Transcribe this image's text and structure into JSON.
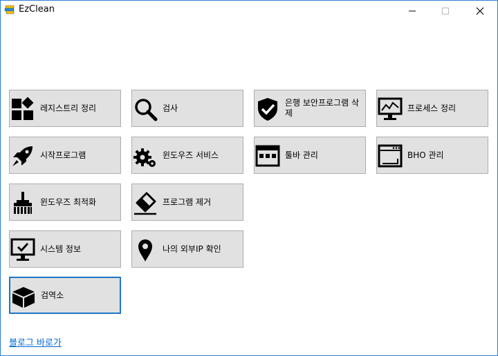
{
  "window": {
    "title": "EzClean"
  },
  "tiles": [
    {
      "label": "레지스트리 정리",
      "icon": "grid-icon"
    },
    {
      "label": "검사",
      "icon": "search-icon"
    },
    {
      "label": "은행 보안프로그램 삭제",
      "icon": "shield-check-icon"
    },
    {
      "label": "프로세스 정리",
      "icon": "monitor-chart-icon"
    },
    {
      "label": "시작프로그램",
      "icon": "rocket-icon"
    },
    {
      "label": "윈도우즈 서비스",
      "icon": "gears-icon"
    },
    {
      "label": "툴바 관리",
      "icon": "toolbar-icon"
    },
    {
      "label": "BHO 관리",
      "icon": "browser-window-icon"
    },
    {
      "label": "윈도우즈 최적화",
      "icon": "broom-icon"
    },
    {
      "label": "프로그램 제거",
      "icon": "eraser-icon"
    },
    {
      "label": "시스템 정보",
      "icon": "monitor-check-icon"
    },
    {
      "label": "나의 외부IP 확인",
      "icon": "map-pin-icon"
    },
    {
      "label": "검역소",
      "icon": "box-icon"
    }
  ],
  "footer": {
    "link": "블로그 바로가"
  }
}
